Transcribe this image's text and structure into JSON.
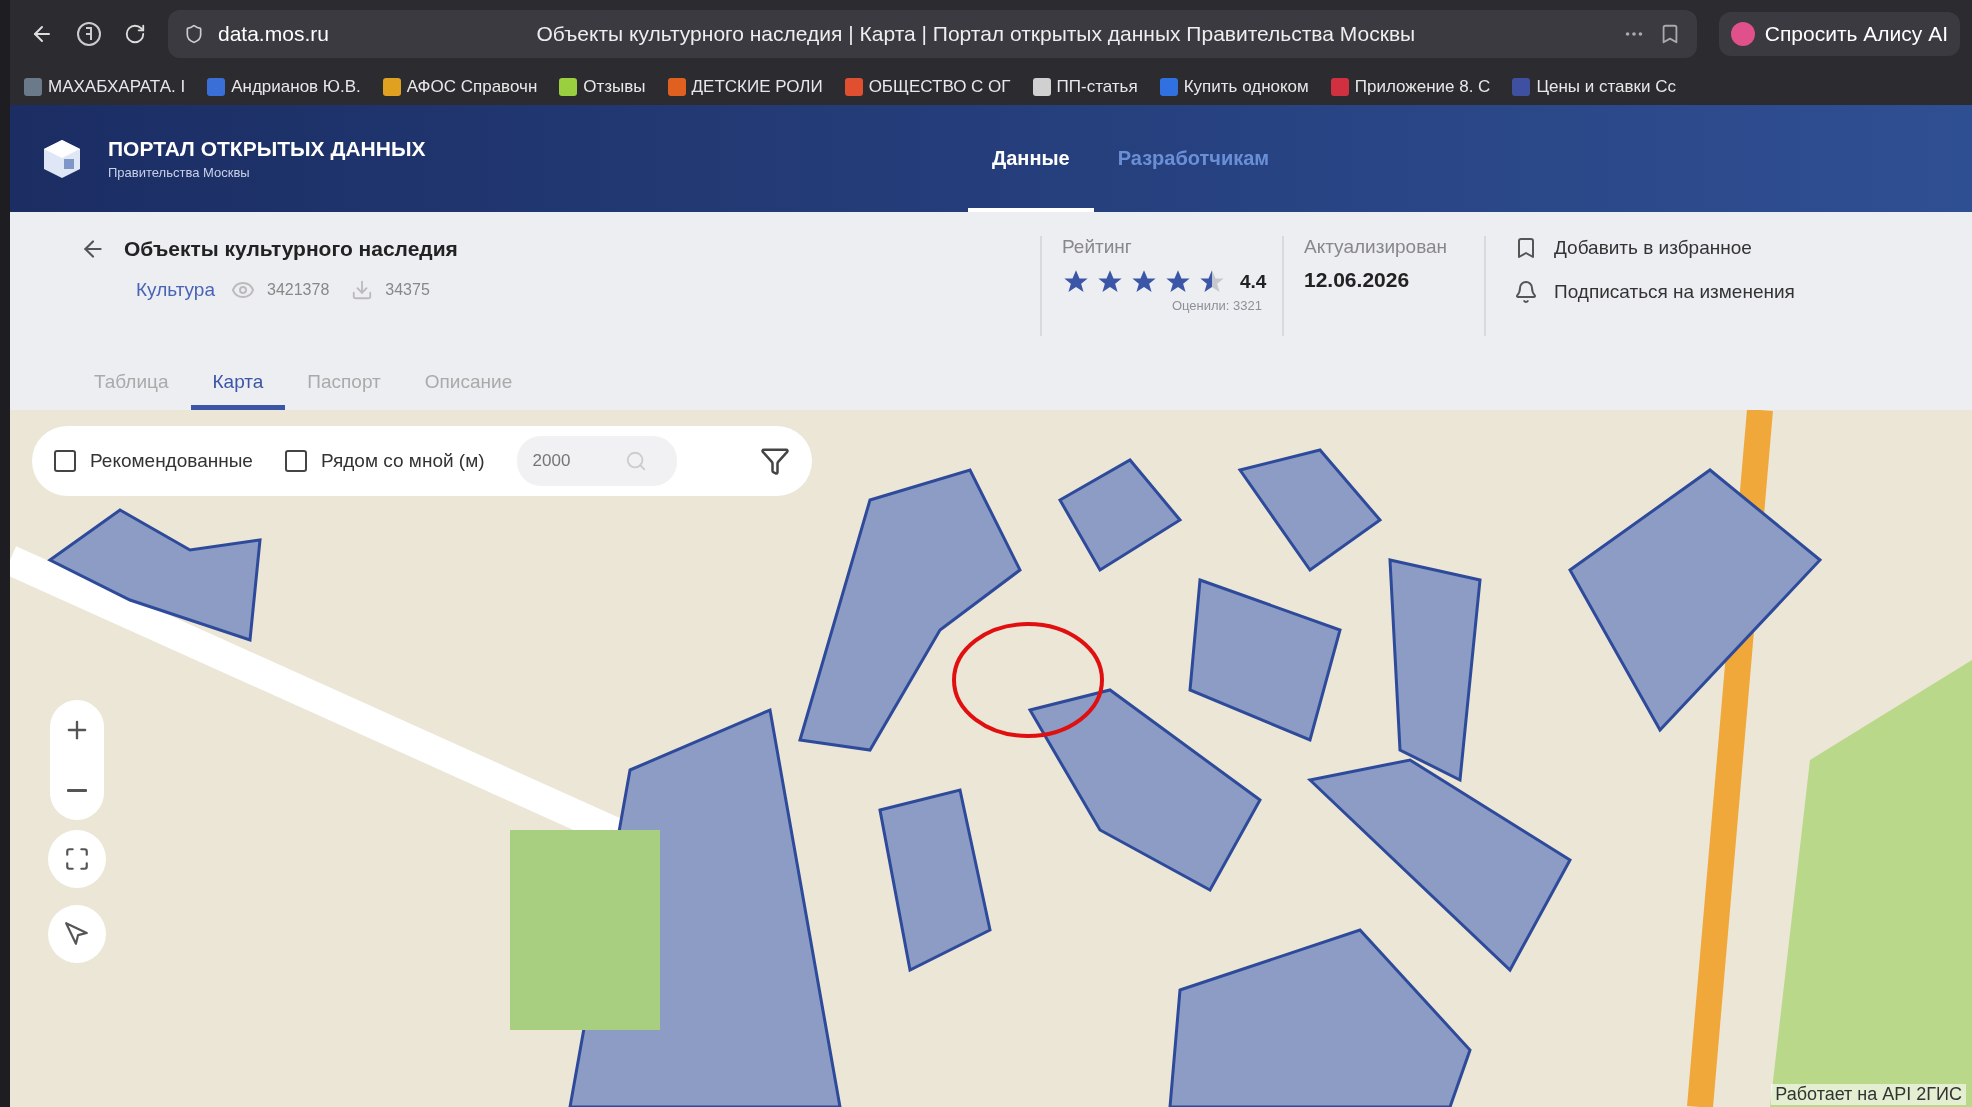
{
  "browser": {
    "address": "data.mos.ru",
    "title": "Объекты культурного наследия | Карта | Портал открытых данных Правительства Москвы",
    "assistant": "Спросить Алису AI"
  },
  "bookmarks": [
    {
      "label": "МАХАБХАРАТА. I",
      "color": "#6a7a8a"
    },
    {
      "label": "Андрианов Ю.В.",
      "color": "#3b6fd8"
    },
    {
      "label": "АФОС Справочн",
      "color": "#e0a020"
    },
    {
      "label": "Отзывы",
      "color": "#9ad040"
    },
    {
      "label": "ДЕТСКИЕ РОЛИ",
      "color": "#e06020"
    },
    {
      "label": "ОБЩЕСТВО С ОГ",
      "color": "#e05030"
    },
    {
      "label": "ПП-статья",
      "color": "#d0d0d0"
    },
    {
      "label": "Купить одноком",
      "color": "#3070e0"
    },
    {
      "label": "Приложение 8. С",
      "color": "#d03040"
    },
    {
      "label": "Цены и ставки Сс",
      "color": "#4050a0"
    }
  ],
  "portal": {
    "name": "ПОРТАЛ ОТКРЫТЫХ ДАННЫХ",
    "subtitle": "Правительства Москвы",
    "nav": [
      {
        "label": "Данные",
        "selected": true
      },
      {
        "label": "Разработчикам",
        "selected": false
      }
    ]
  },
  "dataset": {
    "title": "Объекты культурного наследия",
    "category": "Культура",
    "views": "3421378",
    "downloads": "34375",
    "rating": {
      "label": "Рейтинг",
      "stars": 4.5,
      "value": "4.4",
      "votes": "Оценили: 3321"
    },
    "updated": {
      "label": "Актуализирован",
      "date": "12.06.2026"
    },
    "actions": [
      {
        "kind": "bookmark",
        "label": "Добавить в избранное"
      },
      {
        "kind": "bell",
        "label": "Подписаться на изменения"
      }
    ]
  },
  "tabs": [
    {
      "label": "Таблица",
      "selected": false
    },
    {
      "label": "Карта",
      "selected": true
    },
    {
      "label": "Паспорт",
      "selected": false
    },
    {
      "label": "Описание",
      "selected": false
    }
  ],
  "map": {
    "filters": [
      {
        "label": "Рекомендованные",
        "checked": false
      },
      {
        "label": "Рядом со мной (м)",
        "checked": false
      }
    ],
    "radius": {
      "placeholder": "2000"
    },
    "attribution": "Работает на API 2ГИС"
  }
}
